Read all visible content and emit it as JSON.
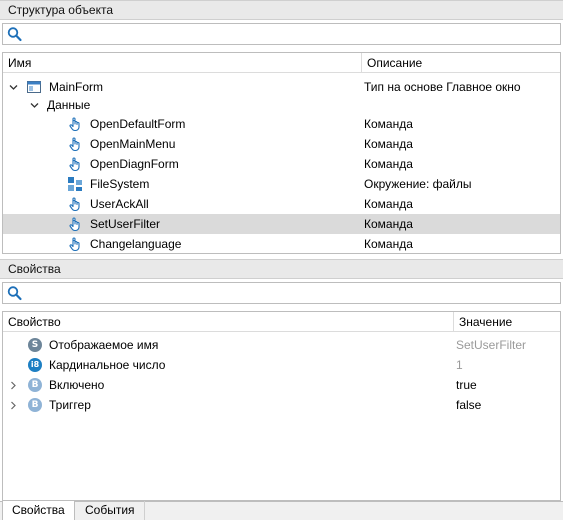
{
  "structure": {
    "title": "Структура объекта",
    "search_placeholder": "",
    "columns": {
      "name": "Имя",
      "description": "Описание"
    },
    "root": {
      "name": "MainForm",
      "description": "Тип на основе Главное окно"
    },
    "group": {
      "name": "Данные"
    },
    "items": [
      {
        "name": "OpenDefaultForm",
        "description": "Команда",
        "icon": "hand-pointer-icon"
      },
      {
        "name": "OpenMainMenu",
        "description": "Команда",
        "icon": "hand-pointer-icon"
      },
      {
        "name": "OpenDiagnForm",
        "description": "Команда",
        "icon": "hand-pointer-icon"
      },
      {
        "name": "FileSystem",
        "description": "Окружение: файлы",
        "icon": "filesystem-icon"
      },
      {
        "name": "UserAckAll",
        "description": "Команда",
        "icon": "hand-pointer-icon"
      },
      {
        "name": "SetUserFilter",
        "description": "Команда",
        "icon": "hand-pointer-icon",
        "selected": true
      },
      {
        "name": "Changelanguage",
        "description": "Команда",
        "icon": "hand-pointer-icon"
      }
    ]
  },
  "properties": {
    "title": "Свойства",
    "search_placeholder": "",
    "columns": {
      "property": "Свойство",
      "value": "Значение"
    },
    "rows": [
      {
        "badge": "S",
        "name": "Отображаемое имя",
        "value": "SetUserFilter",
        "readonly": true
      },
      {
        "badge": "i8",
        "name": "Кардинальное число",
        "value": "1",
        "readonly": true
      },
      {
        "badge": "B",
        "name": "Включено",
        "value": "true",
        "expandable": true
      },
      {
        "badge": "B",
        "name": "Триггер",
        "value": "false",
        "expandable": true
      }
    ]
  },
  "tabs": [
    {
      "label": "Свойства",
      "active": true
    },
    {
      "label": "События",
      "active": false
    }
  ],
  "colors": {
    "selection": "#dadada",
    "header_bg": "#e9e9e9",
    "readonly_text": "#9a9a9a",
    "icon_blue": "#1d7fc3"
  }
}
